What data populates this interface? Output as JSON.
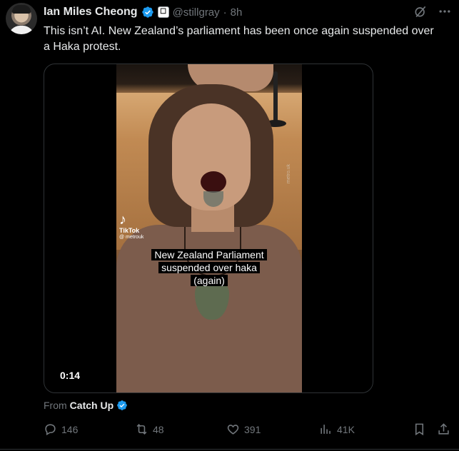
{
  "post": {
    "author_name": "Ian Miles Cheong",
    "handle": "@stillgray",
    "separator": "·",
    "time": "8h",
    "text": "This isn’t AI. New Zealand’s parliament has been once again suspended over a Haka protest.",
    "media": {
      "tiktok_label": "TikTok",
      "tiktok_handle": "@ metrouk",
      "caption": "New Zealand Parliament suspended over haka (again)",
      "watermark": "metro.uk",
      "duration": "0:14"
    },
    "from_label": "From",
    "from_source": "Catch Up",
    "counts": {
      "replies": "146",
      "reposts": "48",
      "likes": "391",
      "views": "41K"
    }
  },
  "colors": {
    "background": "#000000",
    "text": "#e7e9ea",
    "muted": "#71767b",
    "verified": "#1d9bf0",
    "border": "#2f3336"
  },
  "icons": {
    "verified": "verified-badge-icon",
    "affiliate": "affiliate-badge-icon",
    "grok": "grok-icon",
    "more": "more-icon",
    "reply": "reply-icon",
    "repost": "repost-icon",
    "like": "heart-icon",
    "views": "views-icon",
    "bookmark": "bookmark-icon",
    "share": "share-icon"
  }
}
